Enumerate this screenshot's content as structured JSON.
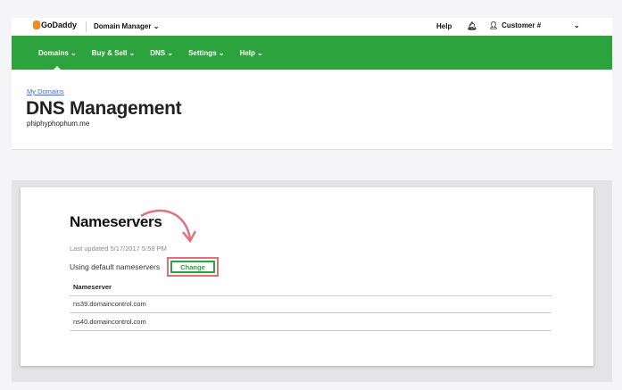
{
  "topbar": {
    "logo": "GoDaddy",
    "product": "Domain Manager",
    "help": "Help",
    "account": "Customer #"
  },
  "nav": {
    "items": [
      "Domains",
      "Buy & Sell",
      "DNS",
      "Settings",
      "Help"
    ]
  },
  "header": {
    "breadcrumb": "My Domains",
    "title": "DNS Management",
    "domain": "phiphyphophum.me"
  },
  "nameservers": {
    "title": "Nameservers",
    "last_updated": "Last updated 5/17/2017 5:58 PM",
    "status": "Using default nameservers",
    "change_label": "Change",
    "column": "Nameserver",
    "rows": [
      "ns39.domaincontrol.com",
      "ns40.domaincontrol.com"
    ]
  },
  "colors": {
    "brand_green": "#2ca33d",
    "highlight": "#e07080"
  }
}
